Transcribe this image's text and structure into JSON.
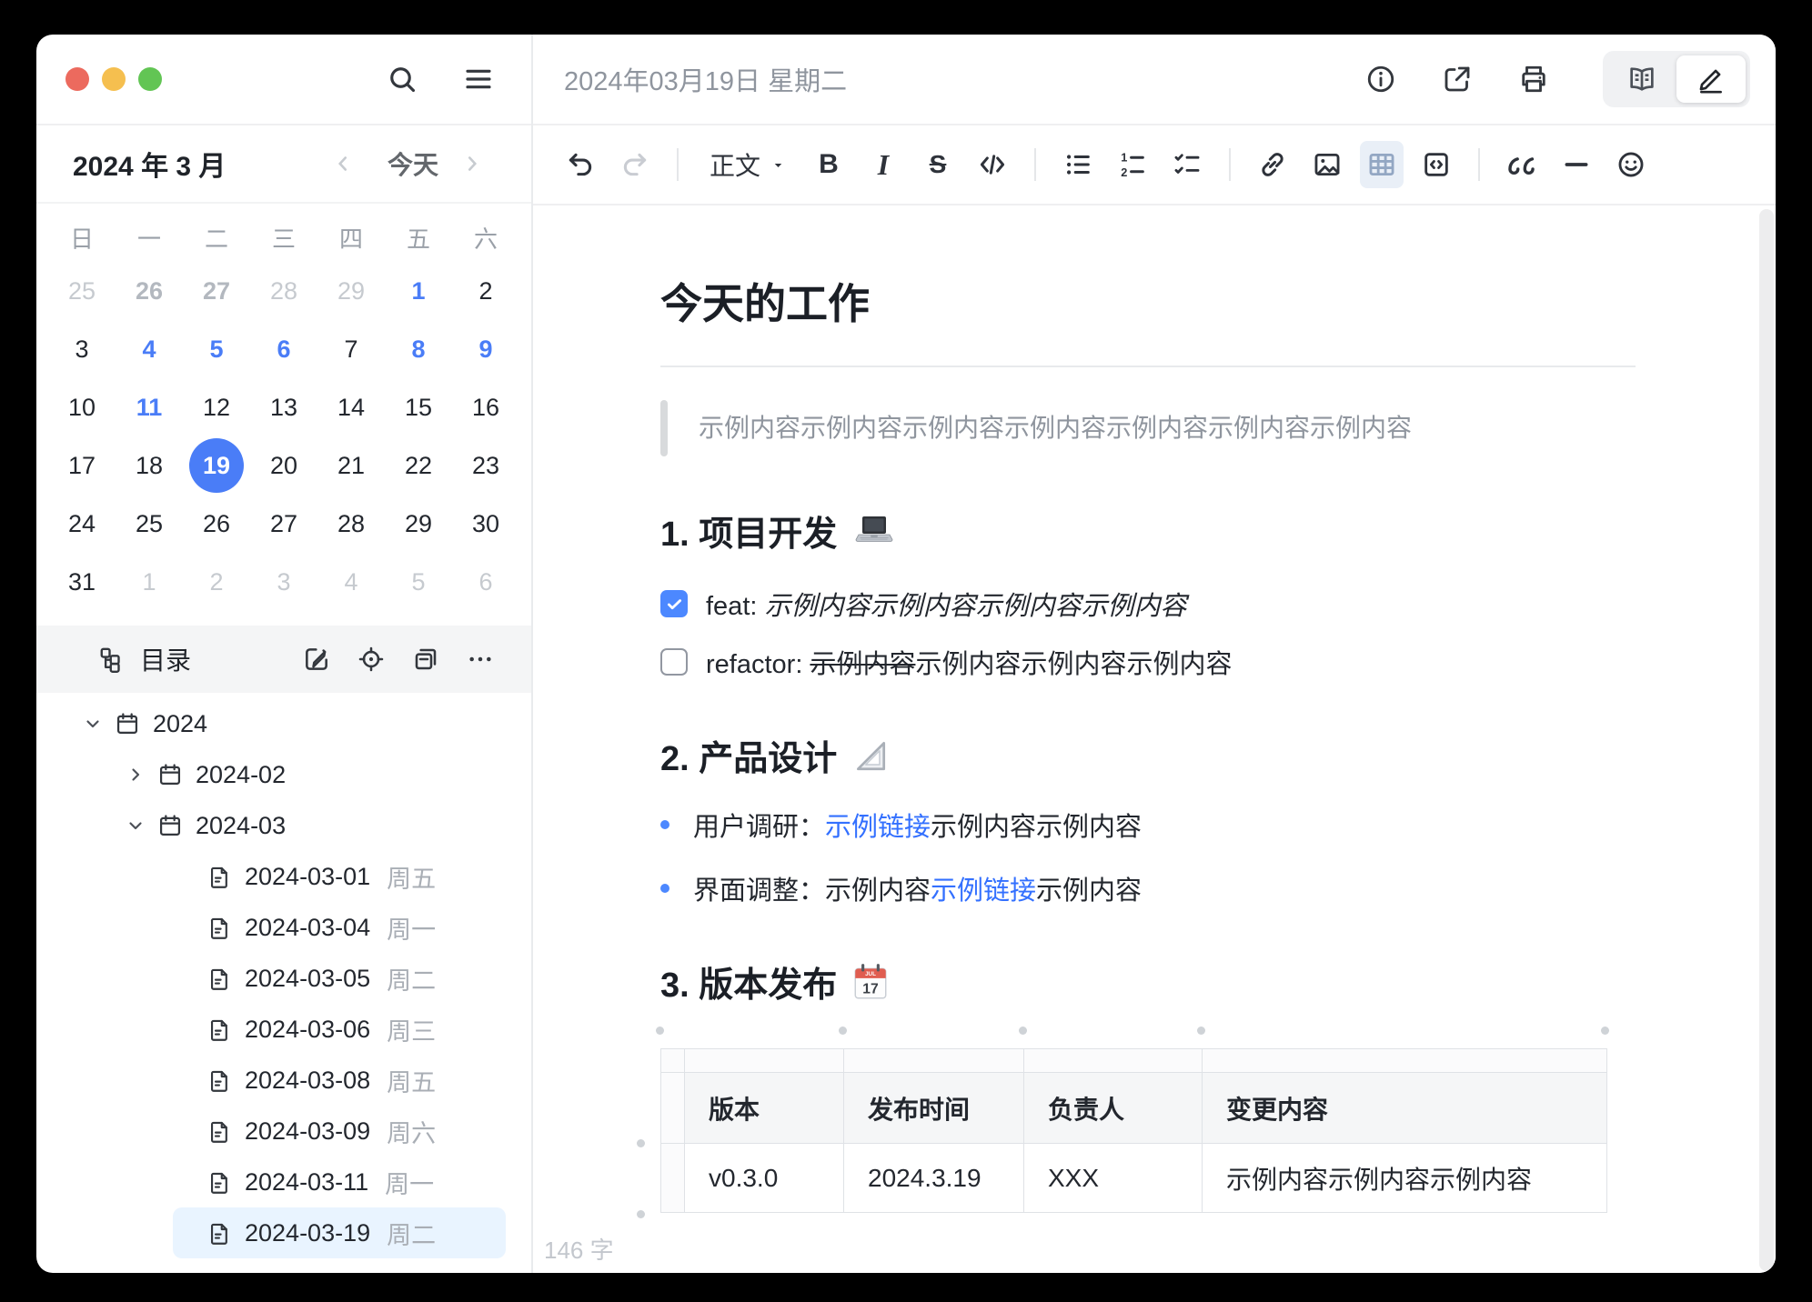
{
  "colors": {
    "accent": "#4a7df7",
    "link": "#3370ff",
    "checkbox_checked": "#4c88ff",
    "selected_file_bg": "#e9f4ff"
  },
  "sidebar": {
    "calendar": {
      "title": "2024 年 3 月",
      "today_label": "今天",
      "weekdays": [
        "日",
        "一",
        "二",
        "三",
        "四",
        "五",
        "六"
      ],
      "cells": [
        {
          "d": "25",
          "s": "om"
        },
        {
          "d": "26",
          "s": "om-note"
        },
        {
          "d": "27",
          "s": "om-note"
        },
        {
          "d": "28",
          "s": "om"
        },
        {
          "d": "29",
          "s": "om"
        },
        {
          "d": "1",
          "s": "note"
        },
        {
          "d": "2",
          "s": "day"
        },
        {
          "d": "3",
          "s": "day"
        },
        {
          "d": "4",
          "s": "note"
        },
        {
          "d": "5",
          "s": "note"
        },
        {
          "d": "6",
          "s": "note"
        },
        {
          "d": "7",
          "s": "day"
        },
        {
          "d": "8",
          "s": "note"
        },
        {
          "d": "9",
          "s": "note"
        },
        {
          "d": "10",
          "s": "day"
        },
        {
          "d": "11",
          "s": "note"
        },
        {
          "d": "12",
          "s": "day"
        },
        {
          "d": "13",
          "s": "day"
        },
        {
          "d": "14",
          "s": "day"
        },
        {
          "d": "15",
          "s": "day"
        },
        {
          "d": "16",
          "s": "day"
        },
        {
          "d": "17",
          "s": "day"
        },
        {
          "d": "18",
          "s": "day"
        },
        {
          "d": "19",
          "s": "today"
        },
        {
          "d": "20",
          "s": "day"
        },
        {
          "d": "21",
          "s": "day"
        },
        {
          "d": "22",
          "s": "day"
        },
        {
          "d": "23",
          "s": "day"
        },
        {
          "d": "24",
          "s": "day"
        },
        {
          "d": "25",
          "s": "day"
        },
        {
          "d": "26",
          "s": "day"
        },
        {
          "d": "27",
          "s": "day"
        },
        {
          "d": "28",
          "s": "day"
        },
        {
          "d": "29",
          "s": "day"
        },
        {
          "d": "30",
          "s": "day"
        },
        {
          "d": "31",
          "s": "day"
        },
        {
          "d": "1",
          "s": "om"
        },
        {
          "d": "2",
          "s": "om"
        },
        {
          "d": "3",
          "s": "om"
        },
        {
          "d": "4",
          "s": "om"
        },
        {
          "d": "5",
          "s": "om"
        },
        {
          "d": "6",
          "s": "om"
        }
      ]
    },
    "directory": {
      "label": "目录"
    },
    "tree": {
      "items": [
        {
          "label": "2024",
          "meta": ""
        },
        {
          "label": "2024-02",
          "meta": ""
        },
        {
          "label": "2024-03",
          "meta": ""
        },
        {
          "label": "2024-03-01",
          "meta": "周五"
        },
        {
          "label": "2024-03-04",
          "meta": "周一"
        },
        {
          "label": "2024-03-05",
          "meta": "周二"
        },
        {
          "label": "2024-03-06",
          "meta": "周三"
        },
        {
          "label": "2024-03-08",
          "meta": "周五"
        },
        {
          "label": "2024-03-09",
          "meta": "周六"
        },
        {
          "label": "2024-03-11",
          "meta": "周一"
        },
        {
          "label": "2024-03-19",
          "meta": "周二"
        }
      ]
    }
  },
  "editor": {
    "header": {
      "title": "2024年03月19日 星期二"
    },
    "toolbar": {
      "paragraph": "正文",
      "bold": "B",
      "italic": "I",
      "strike": "S"
    },
    "doc": {
      "title": "今天的工作",
      "quote": "示例内容示例内容示例内容示例内容示例内容示例内容示例内容",
      "heading1": "1. 项目开发",
      "tasks": [
        {
          "prefix": "feat: ",
          "italic": "示例内容示例内容示例内容示例内容"
        },
        {
          "prefix": "refactor: ",
          "strike": "示例内容",
          "rest": "示例内容示例内容示例内容"
        }
      ],
      "heading2": "2. 产品设计",
      "bullets": [
        {
          "pre": "用户调研：",
          "link": "示例链接",
          "post": "示例内容示例内容"
        },
        {
          "pre": "界面调整：",
          "mid": "示例内容",
          "link": "示例链接",
          "post": "示例内容"
        }
      ],
      "heading3": "3. 版本发布",
      "table": {
        "headers": [
          "版本",
          "发布时间",
          "负责人",
          "变更内容"
        ],
        "rows": [
          [
            "v0.3.0",
            "2024.3.19",
            "XXX",
            "示例内容示例内容示例内容"
          ]
        ]
      }
    },
    "word_count": "146 字"
  }
}
